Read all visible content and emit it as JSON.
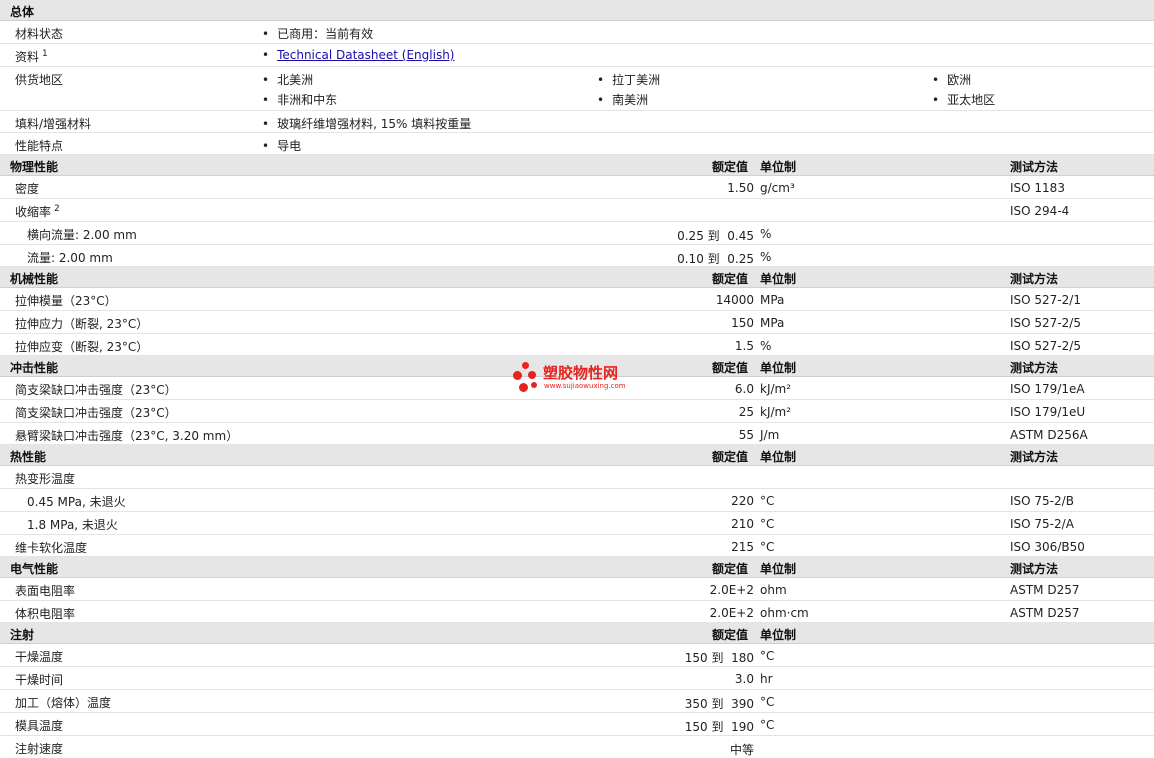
{
  "general": {
    "title": "总体",
    "material_status": {
      "label": "材料状态",
      "value": "已商用：当前有效"
    },
    "literature": {
      "label": "资料",
      "sup": "1",
      "link": "Technical Datasheet (English)"
    },
    "availability": {
      "label": "供货地区",
      "regions": [
        "北美洲",
        "拉丁美洲",
        "欧洲",
        "非洲和中东",
        "南美洲",
        "亚太地区"
      ]
    },
    "filler": {
      "label": "填料/增强材料",
      "value": "玻璃纤维增强材料, 15% 填料按重量"
    },
    "features": {
      "label": "性能特点",
      "value": "导电"
    }
  },
  "columns": {
    "nominal": "额定值",
    "unit": "单位制",
    "method": "测试方法"
  },
  "physical": {
    "title": "物理性能",
    "density": {
      "label": "密度",
      "value": "1.50",
      "unit": "g/cm³",
      "method": "ISO 1183"
    },
    "shrinkage": {
      "label": "收缩率",
      "sup": "2",
      "method": "ISO 294-4"
    },
    "shrink_transverse": {
      "label": "横向流量: 2.00 mm",
      "value": "0.25 到  0.45",
      "unit": "%"
    },
    "shrink_flow": {
      "label": "流量: 2.00 mm",
      "value": "0.10 到  0.25",
      "unit": "%"
    }
  },
  "mechanical": {
    "title": "机械性能",
    "modulus": {
      "label": "拉伸模量（23°C）",
      "value": "14000",
      "unit": "MPa",
      "method": "ISO 527-2/1"
    },
    "stress": {
      "label": "拉伸应力（断裂, 23°C）",
      "value": "150",
      "unit": "MPa",
      "method": "ISO 527-2/5"
    },
    "strain": {
      "label": "拉伸应变（断裂, 23°C）",
      "value": "1.5",
      "unit": "%",
      "method": "ISO 527-2/5"
    }
  },
  "impact": {
    "title": "冲击性能",
    "charpy_notched": {
      "label": "简支梁缺口冲击强度（23°C）",
      "value": "6.0",
      "unit": "kJ/m²",
      "method": "ISO 179/1eA"
    },
    "charpy_unnotched": {
      "label": "简支梁缺口冲击强度（23°C）",
      "value": "25",
      "unit": "kJ/m²",
      "method": "ISO 179/1eU"
    },
    "izod": {
      "label": "悬臂梁缺口冲击强度（23°C, 3.20 mm）",
      "value": "55",
      "unit": "J/m",
      "method": "ASTM D256A"
    }
  },
  "thermal": {
    "title": "热性能",
    "hdt": {
      "label": "热变形温度"
    },
    "hdt_045": {
      "label": "0.45 MPa, 未退火",
      "value": "220",
      "unit": "°C",
      "method": "ISO 75-2/B"
    },
    "hdt_18": {
      "label": "1.8 MPa, 未退火",
      "value": "210",
      "unit": "°C",
      "method": "ISO 75-2/A"
    },
    "vicat": {
      "label": "维卡软化温度",
      "value": "215",
      "unit": "°C",
      "method": "ISO 306/B50"
    }
  },
  "electrical": {
    "title": "电气性能",
    "surface": {
      "label": "表面电阻率",
      "value": "2.0E+2",
      "unit": "ohm",
      "method": "ASTM D257"
    },
    "volume": {
      "label": "体积电阻率",
      "value": "2.0E+2",
      "unit": "ohm·cm",
      "method": "ASTM D257"
    }
  },
  "injection": {
    "title": "注射",
    "drying_temp": {
      "label": "干燥温度",
      "value": "150 到  180",
      "unit": "°C"
    },
    "drying_time": {
      "label": "干燥时间",
      "value": "3.0",
      "unit": "hr"
    },
    "melt_temp": {
      "label": "加工（熔体）温度",
      "value": "350 到  390",
      "unit": "°C"
    },
    "mold_temp": {
      "label": "模具温度",
      "value": "150 到  190",
      "unit": "°C"
    },
    "speed": {
      "label": "注射速度",
      "value": "中等"
    }
  },
  "watermark": {
    "name": "塑胶物性网",
    "url": "www.sujiaowuxing.com",
    "color": "#e8231e"
  }
}
